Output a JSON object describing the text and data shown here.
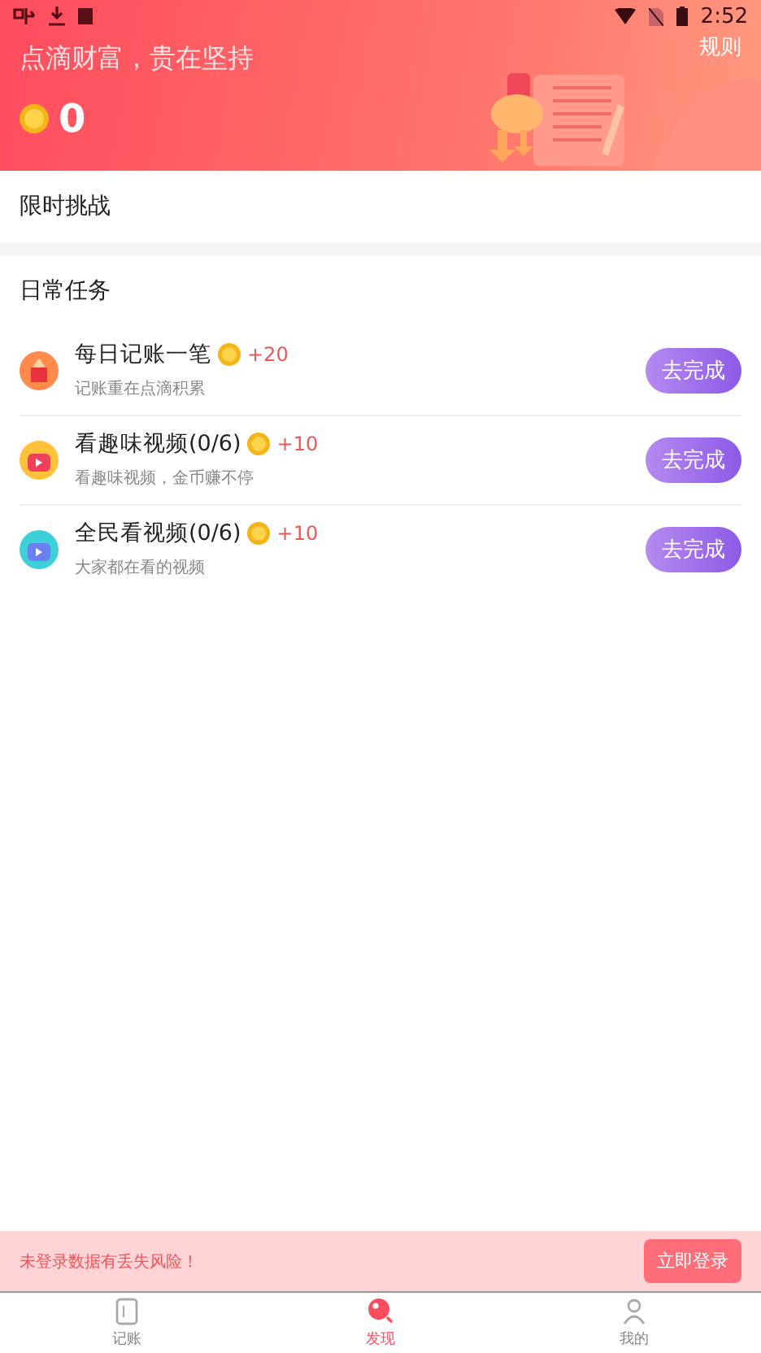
{
  "status_bar": {
    "time": "2:52"
  },
  "header": {
    "slogan": "点滴财富，贵在坚持",
    "rules_link": "规则",
    "coins": "0"
  },
  "sections": [
    {
      "title": "限时挑战"
    },
    {
      "title": "日常任务",
      "tasks": [
        {
          "kind": "pencil",
          "title": "每日记账一笔",
          "reward": "+20",
          "subtitle": "记账重在点滴积累",
          "action": "去完成"
        },
        {
          "kind": "tv-orange",
          "title": "看趣味视频(0/6)",
          "reward": "+10",
          "subtitle": "看趣味视频，金币赚不停",
          "action": "去完成"
        },
        {
          "kind": "tv-blue",
          "title": "全民看视频(0/6)",
          "reward": "+10",
          "subtitle": "大家都在看的视频",
          "action": "去完成"
        }
      ]
    }
  ],
  "login_banner": {
    "message": "未登录数据有丢失风险！",
    "button": "立即登录"
  },
  "tabs": [
    {
      "kind": "book",
      "label": "记账",
      "selected": false
    },
    {
      "kind": "discover",
      "label": "发现",
      "selected": true
    },
    {
      "kind": "person",
      "label": "我的",
      "selected": false
    }
  ]
}
